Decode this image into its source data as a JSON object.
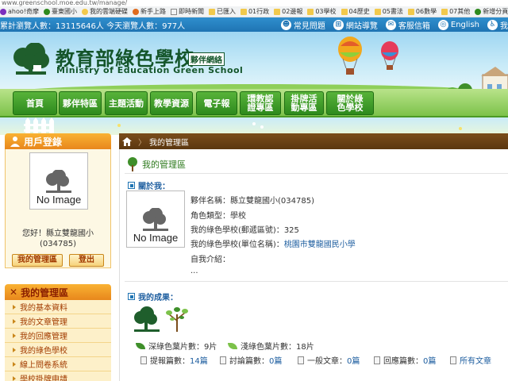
{
  "browser": {
    "url": "www.greenschool.moe.edu.tw/manage/",
    "bookmarks": [
      "ahoo!奇摩",
      "臺東國小",
      "我的雲端硬碟",
      "新手上路",
      "即時新聞",
      "已匯入",
      "01行政",
      "02邊報",
      "03學校",
      "04歷史",
      "05書法",
      "06數學",
      "07其他",
      "新增分頁"
    ]
  },
  "topbar": {
    "stats": "累計瀏覽人數：13115646人 今天瀏覽人數：977人",
    "links": [
      "常見問題",
      "網站導覽",
      "客服信箱",
      "English",
      "我"
    ]
  },
  "header": {
    "title_zh": "教育部綠色學校",
    "title_sub": "夥伴網絡",
    "title_en": "Ministry of Education Green School"
  },
  "nav": {
    "items": [
      "首頁",
      "夥伴特區",
      "主題活動",
      "教學資源",
      "電子報",
      "環教認證專區",
      "掛牌活動專區",
      "關於綠色學校"
    ]
  },
  "sidebar": {
    "login_title": "用戶登錄",
    "no_image": "No Image",
    "greeting_line1": "您好！縣立雙龍國小",
    "greeting_line2": "(034785)",
    "btn_manage": "我的管理區",
    "btn_logout": "登出",
    "menu_title": "我的管理區",
    "menu_items": [
      "我的基本資料",
      "我的文章管理",
      "我的回應管理",
      "我的綠色學校",
      "線上問卷系統",
      "學校掛牌申請"
    ]
  },
  "breadcrumb": {
    "current": "我的管理區"
  },
  "main": {
    "section_title": "我的管理區",
    "about_title": "關於我：",
    "no_image": "No Image",
    "fields": {
      "partner_name_label": "夥伴名稱：",
      "partner_name_value": "縣立雙龍國小(034785)",
      "role_type_label": "角色類型：",
      "role_type_value": "學校",
      "postal_label": "我的綠色學校(郵遞區號)：",
      "postal_value": "325",
      "unit_label": "我的綠色學校(單位名稱)：",
      "unit_value": "桃園市雙龍國民小學",
      "intro_label": "自我介紹：",
      "intro_value": "..."
    },
    "achievements_title": "我的成果：",
    "deep_leaves_label": "深綠色葉片數：",
    "deep_leaves_value": "9片",
    "light_leaves_label": "淺綠色葉片數：",
    "light_leaves_value": "18片",
    "stats": [
      {
        "label": "提報篇數：",
        "value": "14篇"
      },
      {
        "label": "討論篇數：",
        "value": "0篇"
      },
      {
        "label": "一般文章：",
        "value": "0篇"
      },
      {
        "label": "回應篇數：",
        "value": "0篇"
      },
      {
        "label": "所有文章",
        "value": ""
      }
    ]
  },
  "colors": {
    "topbar": "#1f74b3",
    "nav_green": "#2e8a1d",
    "sidebar_orange": "#e8871c",
    "breadcrumb_brown": "#5b360f"
  }
}
